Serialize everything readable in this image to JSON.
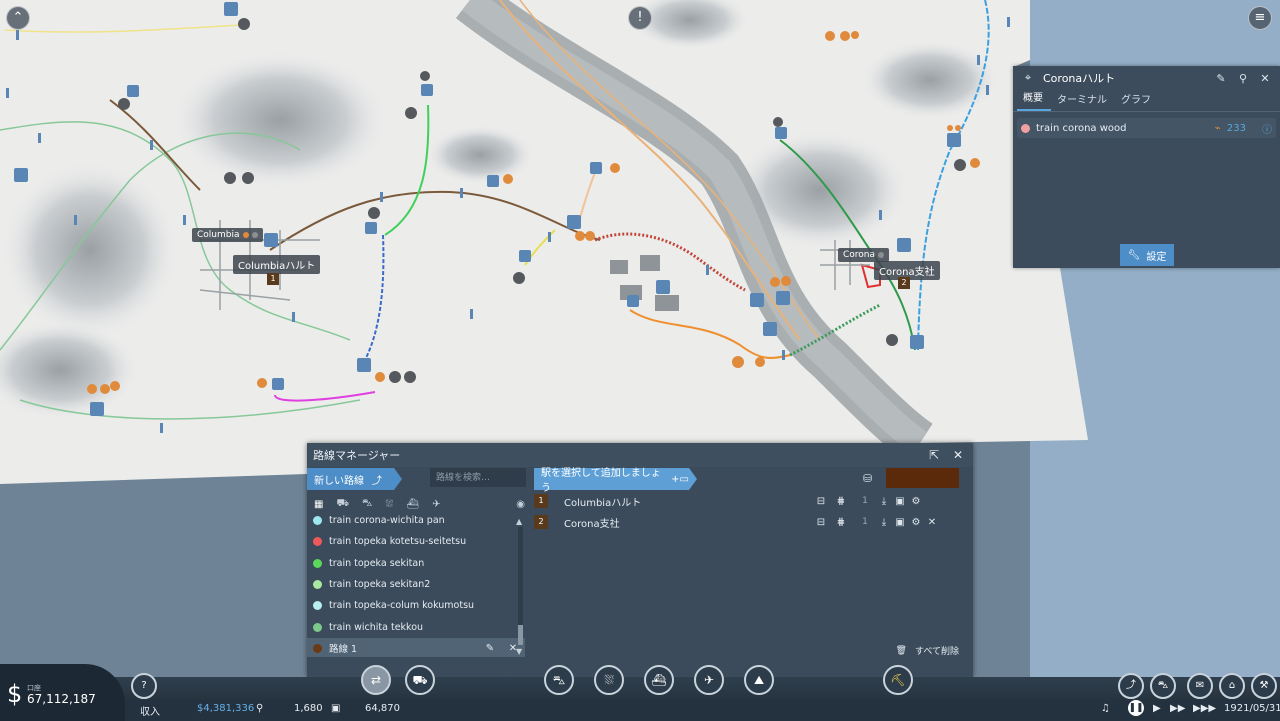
{
  "map": {
    "labels": {
      "columbia_town": "Columbia",
      "columbia_halt": "Columbiaハルト",
      "corona_town": "Corona",
      "corona_branch": "Corona支社"
    },
    "stop_numbers": {
      "one": "1",
      "two": "2"
    }
  },
  "station_panel": {
    "title": "Coronaハルト",
    "tabs": [
      "概要",
      "ターミナル",
      "グラフ"
    ],
    "lines": [
      {
        "name": "train corona wood",
        "value": "233",
        "color": "#f0a0a0"
      }
    ],
    "settings_label": "設定"
  },
  "line_manager": {
    "title": "路線マネージャー",
    "new_line_label": "新しい路線",
    "search_placeholder": "路線を検索…",
    "add_station_label": "駅を選択して追加しましょう",
    "line_color": "#5b2a0a",
    "lines": [
      {
        "name": "train corona-wichita pan",
        "color": "#9ee6f0"
      },
      {
        "name": "train topeka kotetsu-seitetsu",
        "color": "#ee5a5a"
      },
      {
        "name": "train topeka sekitan",
        "color": "#5cd65c"
      },
      {
        "name": "train topeka sekitan2",
        "color": "#a8e8a0"
      },
      {
        "name": "train topeka-colum kokumotsu",
        "color": "#b8f0f0"
      },
      {
        "name": "train wichita tekkou",
        "color": "#7cc98a"
      },
      {
        "name": "路線 1",
        "color": "#6b3a14"
      }
    ],
    "stops": [
      {
        "number": "1",
        "name": "Columbiaハルト",
        "count": "1"
      },
      {
        "number": "2",
        "name": "Corona支社",
        "count": "1"
      }
    ],
    "clear_all_label": "すべて削除"
  },
  "status": {
    "account_label": "口座",
    "balance": "67,112,187",
    "income_label": "収入",
    "income": "$4,381,336",
    "population": "1,680",
    "cargo": "64,870",
    "date": "1921/05/31"
  }
}
